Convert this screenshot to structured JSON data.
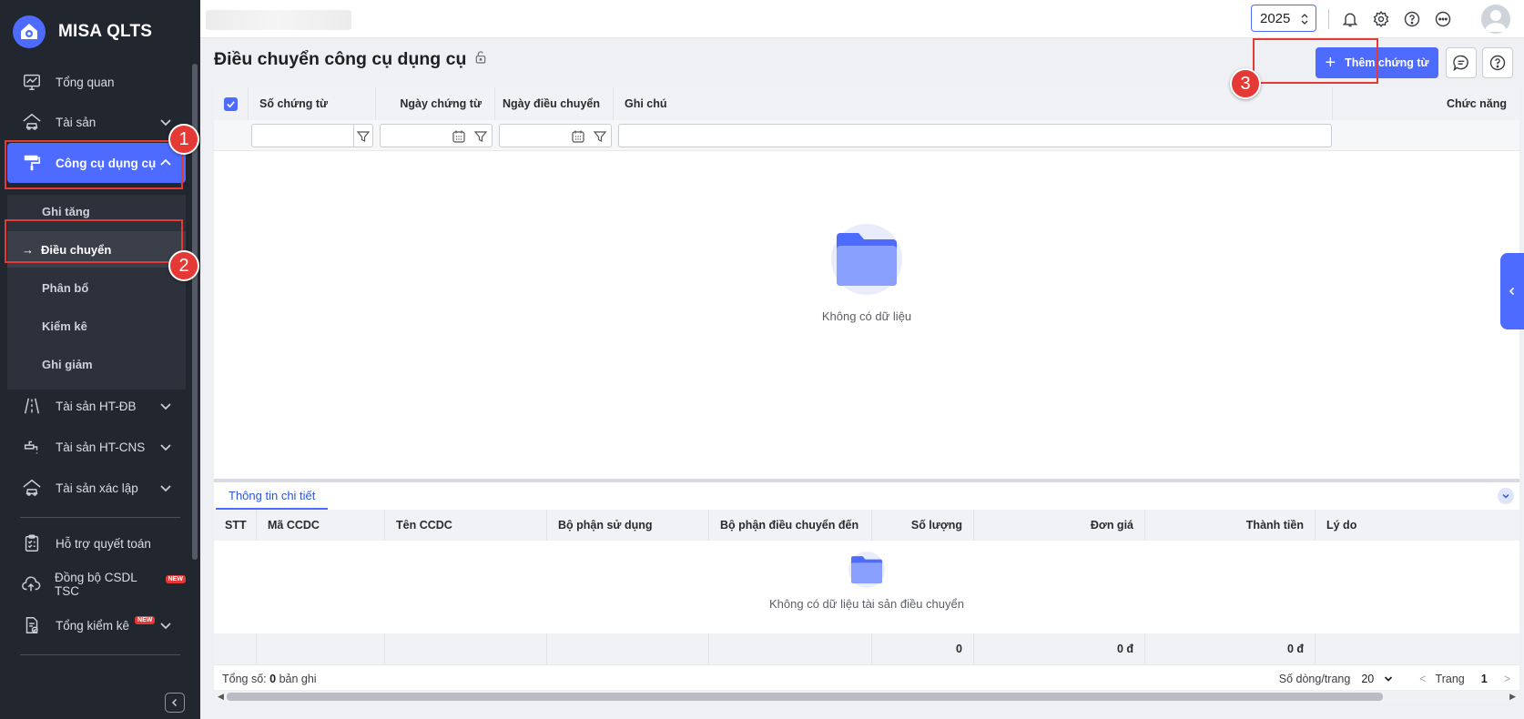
{
  "app": {
    "name": "MISA QLTS"
  },
  "sidebar": {
    "items": [
      {
        "label": "Tổng quan",
        "icon": "monitor-chart-icon",
        "has_children": false
      },
      {
        "label": "Tài sản",
        "icon": "car-house-icon",
        "has_children": true
      },
      {
        "label": "Công cụ dụng cụ",
        "icon": "paint-roller-icon",
        "has_children": true,
        "active": true
      }
    ],
    "submenu": [
      {
        "label": "Ghi tăng"
      },
      {
        "label": "Điều chuyển",
        "current": true
      },
      {
        "label": "Phân bổ"
      },
      {
        "label": "Kiểm kê"
      },
      {
        "label": "Ghi giảm"
      }
    ],
    "items_after": [
      {
        "label": "Tài sản HT-ĐB",
        "icon": "road-icon",
        "has_children": true
      },
      {
        "label": "Tài sản HT-CNS",
        "icon": "water-tap-icon",
        "has_children": true
      },
      {
        "label": "Tài sản xác lập",
        "icon": "car-house-icon",
        "has_children": true
      },
      {
        "label": "Hỗ trợ quyết toán",
        "icon": "clipboard-check-icon",
        "has_children": false
      },
      {
        "label": "Đồng bộ CSDL TSC",
        "icon": "cloud-upload-icon",
        "badge": "NEW"
      },
      {
        "label": "Tổng kiểm kê",
        "icon": "document-check-icon",
        "badge": "NEW",
        "has_children": true
      }
    ],
    "current_arrow": "→"
  },
  "topbar": {
    "year": "2025"
  },
  "page": {
    "title": "Điều chuyển công cụ dụng cụ",
    "add_button": "Thêm chứng từ",
    "plus": "+"
  },
  "grid": {
    "columns": [
      "Số chứng từ",
      "Ngày chứng từ",
      "Ngày điều chuyển",
      "Ghi chú",
      "Chức năng"
    ],
    "empty_text": "Không có dữ liệu"
  },
  "detail": {
    "tab": "Thông tin chi tiết",
    "columns": [
      "STT",
      "Mã CCDC",
      "Tên CCDC",
      "Bộ phận sử dụng",
      "Bộ phận điều chuyển đến",
      "Số lượng",
      "Đơn giá",
      "Thành tiền",
      "Lý do"
    ],
    "empty_text": "Không có dữ liệu tài sản điều chuyển",
    "totals": {
      "quantity": "0",
      "unit_price": "0 đ",
      "amount": "0 đ"
    }
  },
  "footer": {
    "total_prefix": "Tổng số:",
    "total_count": "0",
    "total_suffix": "bản ghi",
    "rows_per_page_label": "Số dòng/trang",
    "rows_per_page": "20",
    "prev": "<",
    "page_label": "Trang",
    "page": "1",
    "next": ">"
  },
  "annotations": [
    "1",
    "2",
    "3"
  ],
  "colors": {
    "primary": "#4d6bfe",
    "sidebar": "#22262f",
    "annotation": "#e53935"
  }
}
